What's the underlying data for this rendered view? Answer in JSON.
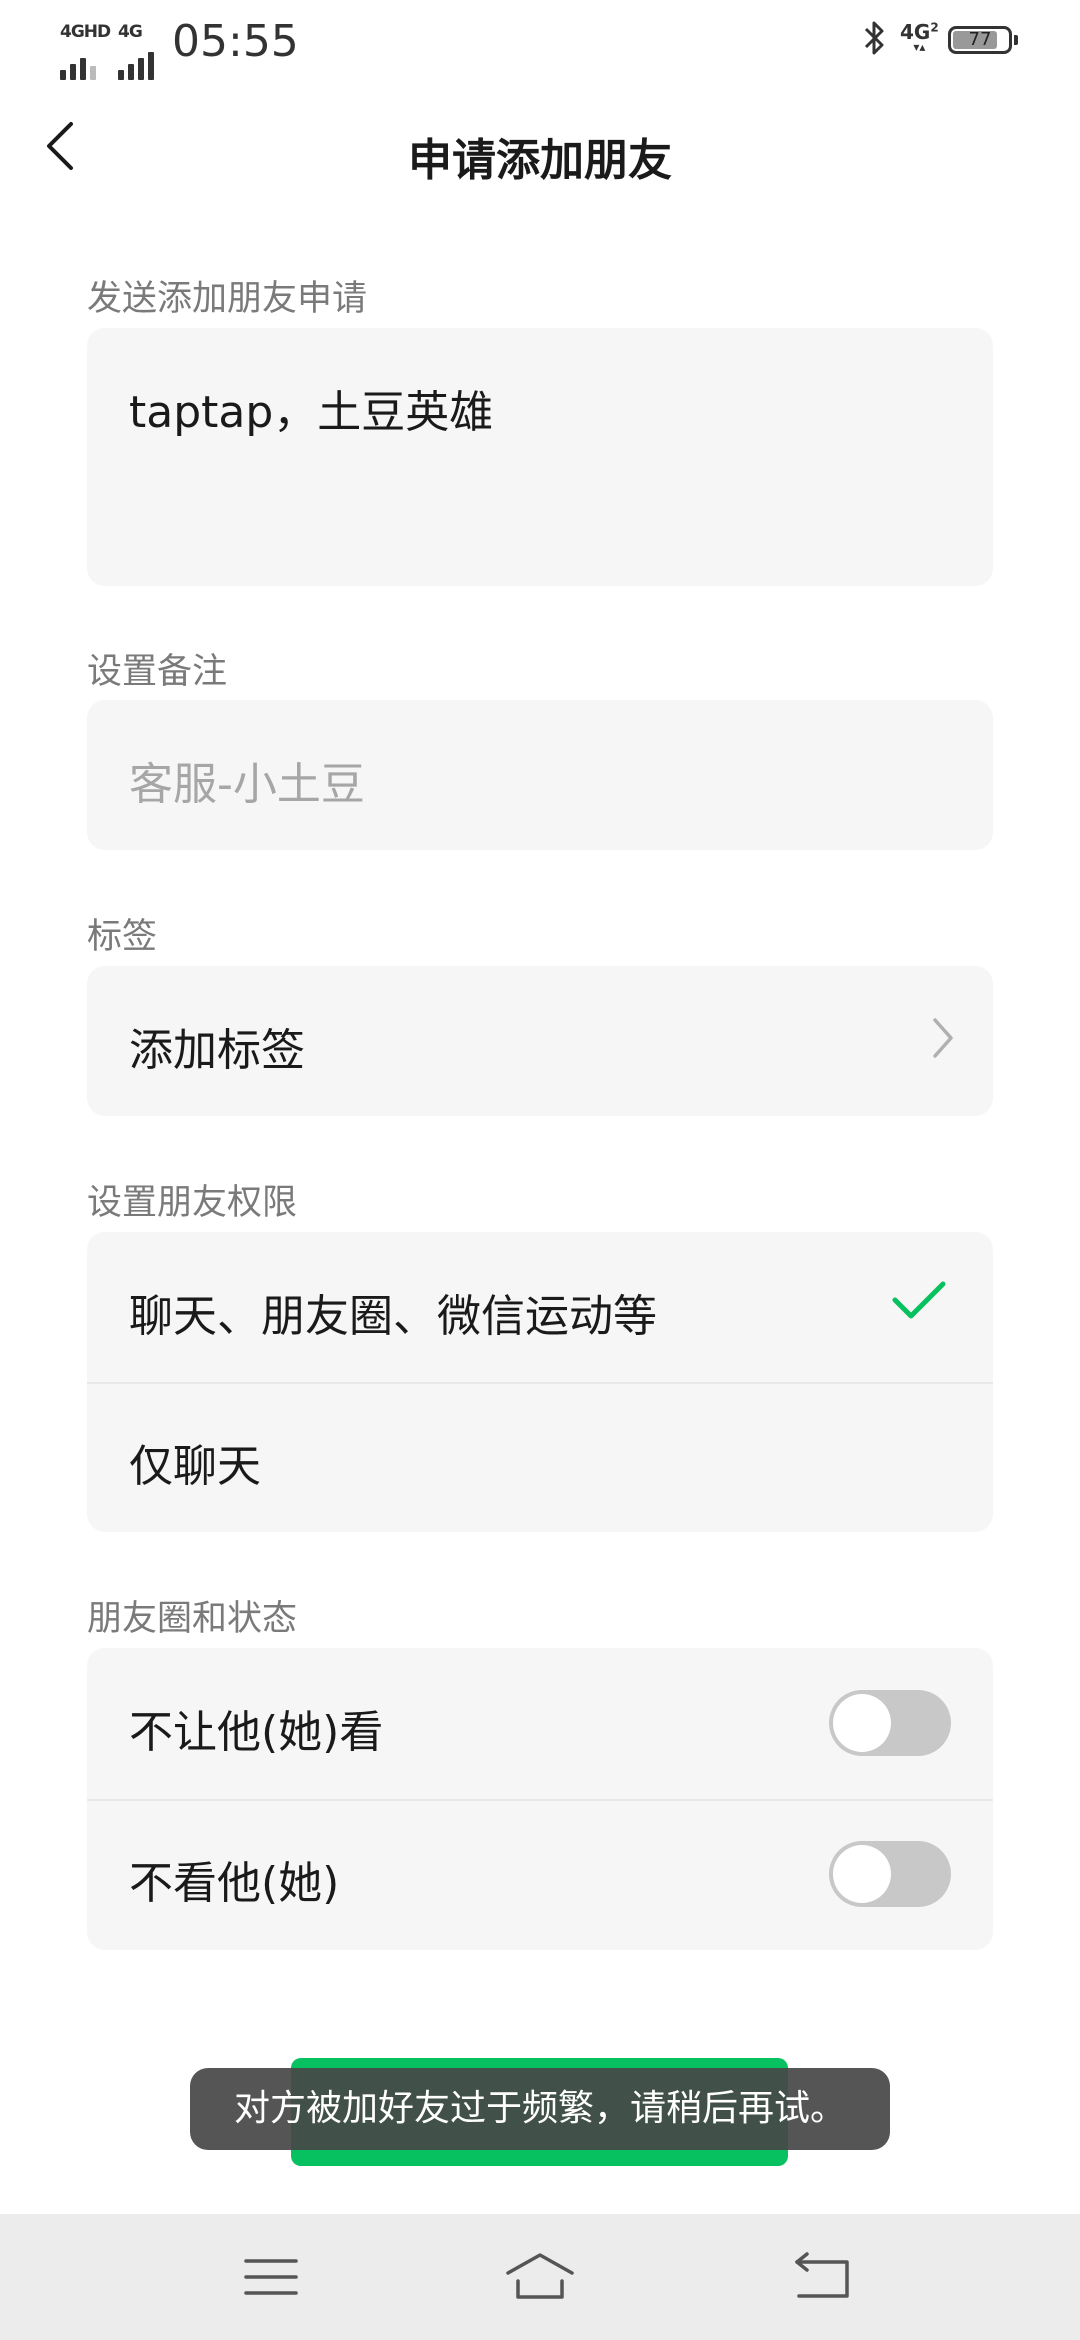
{
  "status_bar": {
    "time": "05:55",
    "signal_1": "4GHD",
    "signal_2": "4G",
    "network": "4G",
    "network_sub": "2",
    "battery": "77"
  },
  "header": {
    "title": "申请添加朋友"
  },
  "send_request": {
    "label": "发送添加朋友申请",
    "message": "taptap，土豆英雄"
  },
  "remark": {
    "label": "设置备注",
    "placeholder": "客服-小土豆"
  },
  "tags": {
    "label": "标签",
    "add_label": "添加标签"
  },
  "permissions": {
    "label": "设置朋友权限",
    "options": [
      {
        "label": "聊天、朋友圈、微信运动等",
        "selected": true
      },
      {
        "label": "仅聊天",
        "selected": false
      }
    ]
  },
  "moments": {
    "label": "朋友圈和状态",
    "options": [
      {
        "label": "不让他(她)看",
        "enabled": false
      },
      {
        "label": "不看他(她)",
        "enabled": false
      }
    ]
  },
  "toast": {
    "message": "对方被加好友过于频繁，请稍后再试。"
  },
  "colors": {
    "accent": "#07c160",
    "card_bg": "#f6f6f6",
    "toggle_off": "#c8c8c8"
  }
}
